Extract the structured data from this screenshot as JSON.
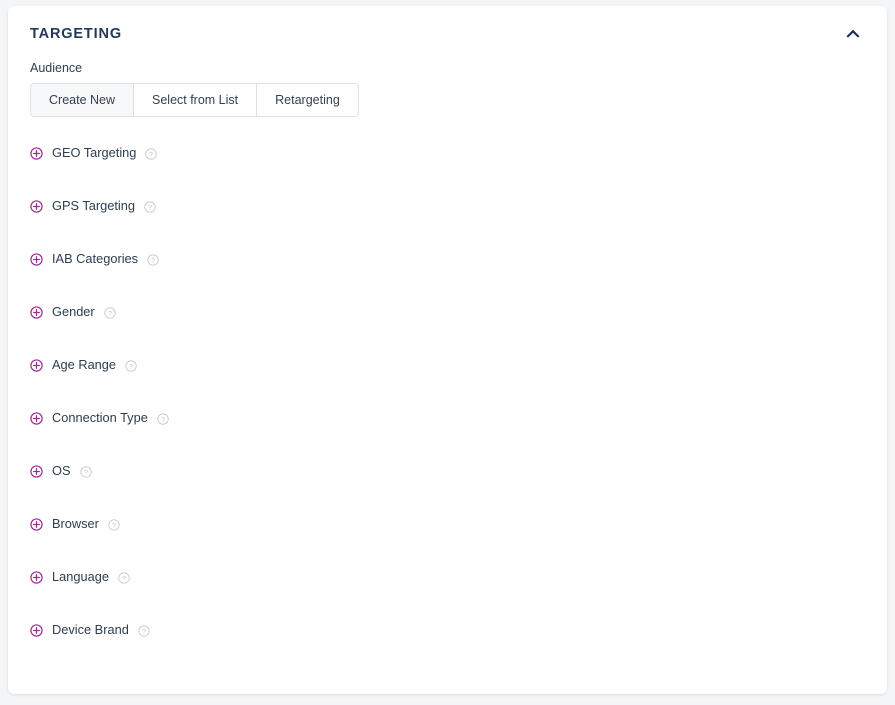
{
  "panel": {
    "title": "TARGETING",
    "collapse_icon": "chevron-up-icon",
    "collapsed": false
  },
  "audience": {
    "label": "Audience",
    "selected": "Create New",
    "options": [
      {
        "label": "Create New",
        "active": true
      },
      {
        "label": "Select from List",
        "active": false
      },
      {
        "label": "Retargeting",
        "active": false
      }
    ]
  },
  "targeting_items": [
    {
      "label": "GEO Targeting",
      "expand_icon": "plus-circle-icon",
      "help_icon": "question-circle-icon"
    },
    {
      "label": "GPS Targeting",
      "expand_icon": "plus-circle-icon",
      "help_icon": "question-circle-icon"
    },
    {
      "label": "IAB Categories",
      "expand_icon": "plus-circle-icon",
      "help_icon": "question-circle-icon"
    },
    {
      "label": "Gender",
      "expand_icon": "plus-circle-icon",
      "help_icon": "question-circle-icon"
    },
    {
      "label": "Age Range",
      "expand_icon": "plus-circle-icon",
      "help_icon": "question-circle-icon"
    },
    {
      "label": "Connection Type",
      "expand_icon": "plus-circle-icon",
      "help_icon": "question-circle-icon"
    },
    {
      "label": "OS",
      "expand_icon": "plus-circle-icon",
      "help_icon": "question-circle-icon"
    },
    {
      "label": "Browser",
      "expand_icon": "plus-circle-icon",
      "help_icon": "question-circle-icon"
    },
    {
      "label": "Language",
      "expand_icon": "plus-circle-icon",
      "help_icon": "question-circle-icon"
    },
    {
      "label": "Device Brand",
      "expand_icon": "plus-circle-icon",
      "help_icon": "question-circle-icon"
    }
  ],
  "colors": {
    "page_background": "#f4f5f7",
    "card_background": "#ffffff",
    "title_text": "#253858",
    "body_text": "#2c3e50",
    "accent_purple": "#9b2d8f",
    "border": "#dfe1e6",
    "help_grey": "#b9bdc4",
    "active_segment": "#f7f8f9"
  }
}
